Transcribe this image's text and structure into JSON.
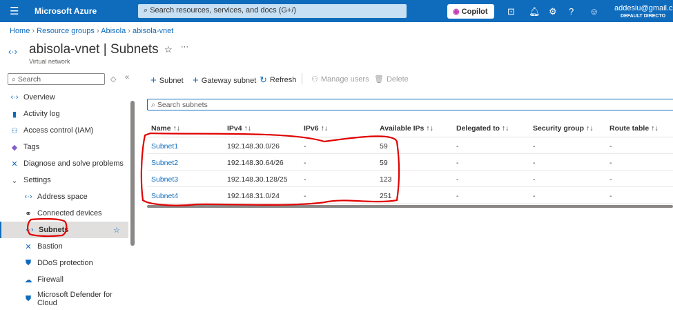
{
  "topbar": {
    "brand": "Microsoft Azure",
    "search_placeholder": "Search resources, services, and docs (G+/)",
    "copilot": "Copilot",
    "user": "addesiu@gmail.co",
    "directory": "DEFAULT DIRECTO"
  },
  "breadcrumb": [
    "Home",
    "Resource groups",
    "Abisola",
    "abisola-vnet"
  ],
  "header": {
    "title": "abisola-vnet | Subnets",
    "subtitle": "Virtual network",
    "more": "···"
  },
  "sidebar": {
    "search_placeholder": "Search",
    "items": [
      {
        "label": "Overview",
        "icon": "vnet-icon"
      },
      {
        "label": "Activity log",
        "icon": "activity-log-icon"
      },
      {
        "label": "Access control (IAM)",
        "icon": "iam-icon"
      },
      {
        "label": "Tags",
        "icon": "tag-icon"
      },
      {
        "label": "Diagnose and solve problems",
        "icon": "diagnose-icon"
      },
      {
        "label": "Settings",
        "icon": "chevron-down-icon"
      },
      {
        "label": "Address space",
        "icon": "vnet-icon"
      },
      {
        "label": "Connected devices",
        "icon": "plug-icon"
      },
      {
        "label": "Subnets",
        "icon": "vnet-icon",
        "selected": true
      },
      {
        "label": "Bastion",
        "icon": "bastion-icon"
      },
      {
        "label": "DDoS protection",
        "icon": "shield-icon"
      },
      {
        "label": "Firewall",
        "icon": "firewall-icon"
      },
      {
        "label": "Microsoft Defender for",
        "label2": "Cloud",
        "icon": "defender-icon"
      }
    ]
  },
  "toolbar": {
    "subnet": "Subnet",
    "gateway": "Gateway subnet",
    "refresh": "Refresh",
    "manage_users": "Manage users",
    "delete": "Delete"
  },
  "table": {
    "search_placeholder": "Search subnets",
    "columns": [
      "Name ↑↓",
      "IPv4 ↑↓",
      "IPv6 ↑↓",
      "Available IPs ↑↓",
      "Delegated to ↑↓",
      "Security group ↑↓",
      "Route table ↑↓"
    ],
    "rows": [
      [
        "Subnet1",
        "192.148.30.0/26",
        "-",
        "59",
        "-",
        "-",
        "-"
      ],
      [
        "Subnet2",
        "192.148.30.64/26",
        "-",
        "59",
        "-",
        "-",
        "-"
      ],
      [
        "Subnet3",
        "192.148.30.128/25",
        "-",
        "123",
        "-",
        "-",
        "-"
      ],
      [
        "Subnet4",
        "192.148.31.0/24",
        "-",
        "251",
        "-",
        "-",
        "-"
      ]
    ]
  },
  "colors": {
    "accent": "#0f6cbd",
    "annotation": "#e00000"
  }
}
